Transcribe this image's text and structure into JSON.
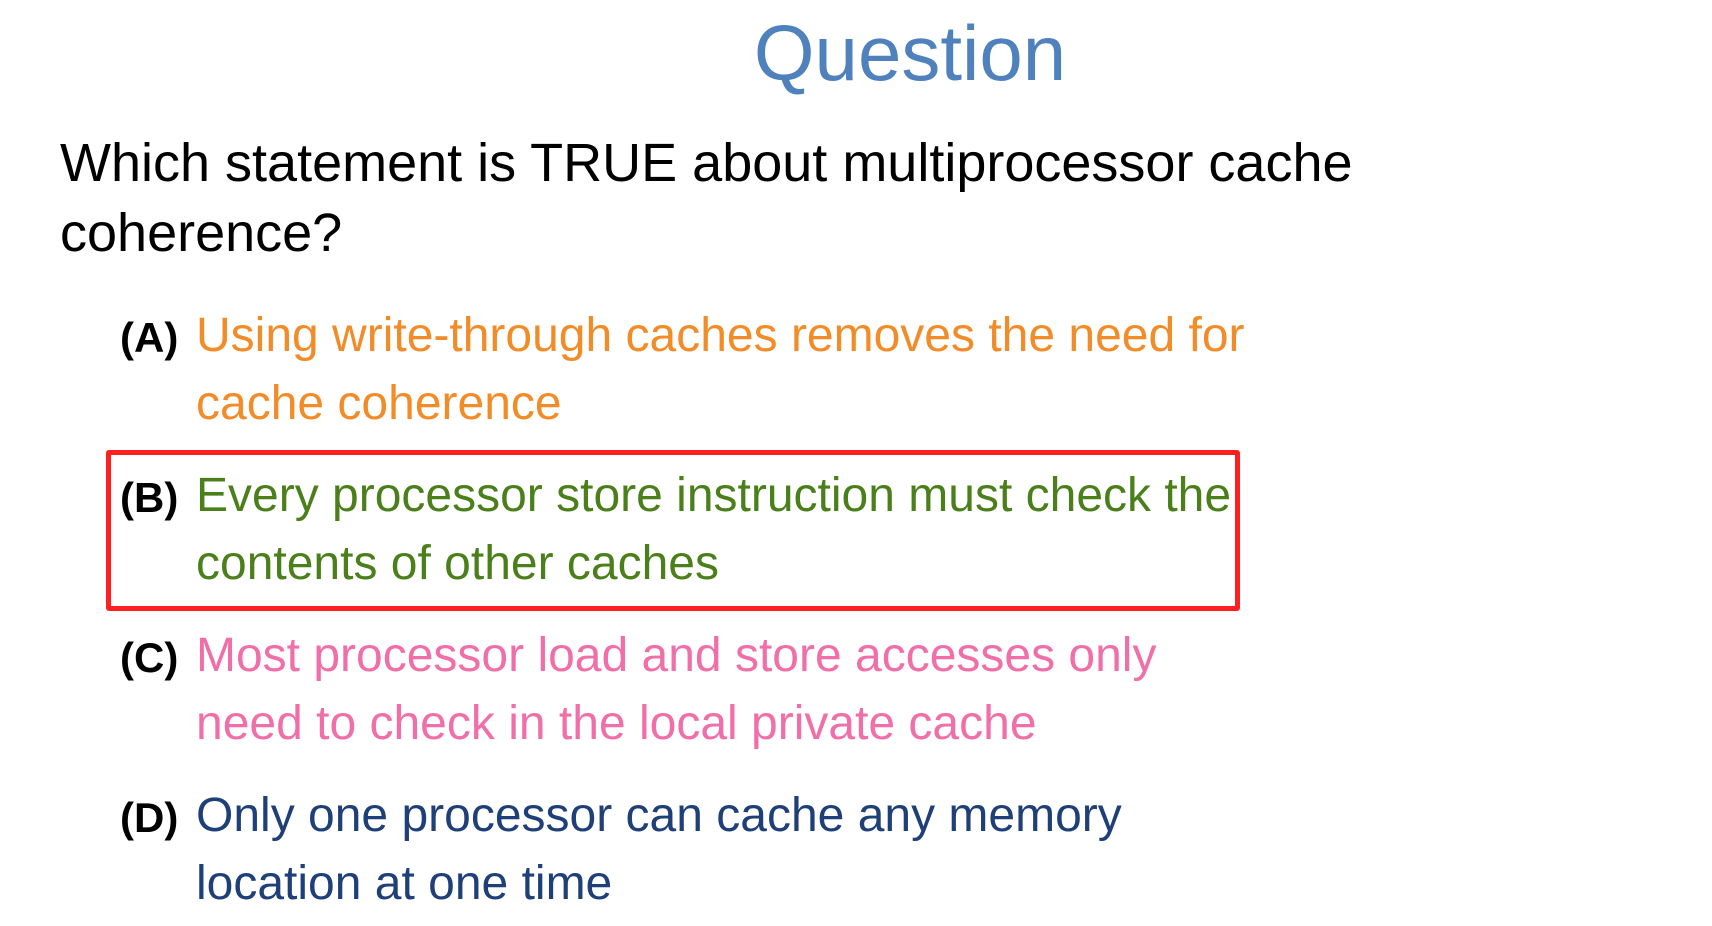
{
  "slide": {
    "title": "Question",
    "question": "Which statement is TRUE about multiprocessor cache coherence?",
    "options": [
      {
        "letter": "(A)",
        "text": "Using write-through caches removes the need for cache coherence",
        "color": "#f28c28"
      },
      {
        "letter": "(B)",
        "text": "Every processor store instruction must check the contents of other caches",
        "color": "#4a7f1a",
        "highlighted": true
      },
      {
        "letter": "(C)",
        "text": "Most processor load and store accesses only need to check in the local private cache",
        "color": "#f06fa8"
      },
      {
        "letter": "(D)",
        "text": "Only one processor can cache any memory location at one time",
        "color": "#1f3f78"
      }
    ],
    "title_color": "#4f81bd",
    "highlight_color": "#ff2020"
  }
}
